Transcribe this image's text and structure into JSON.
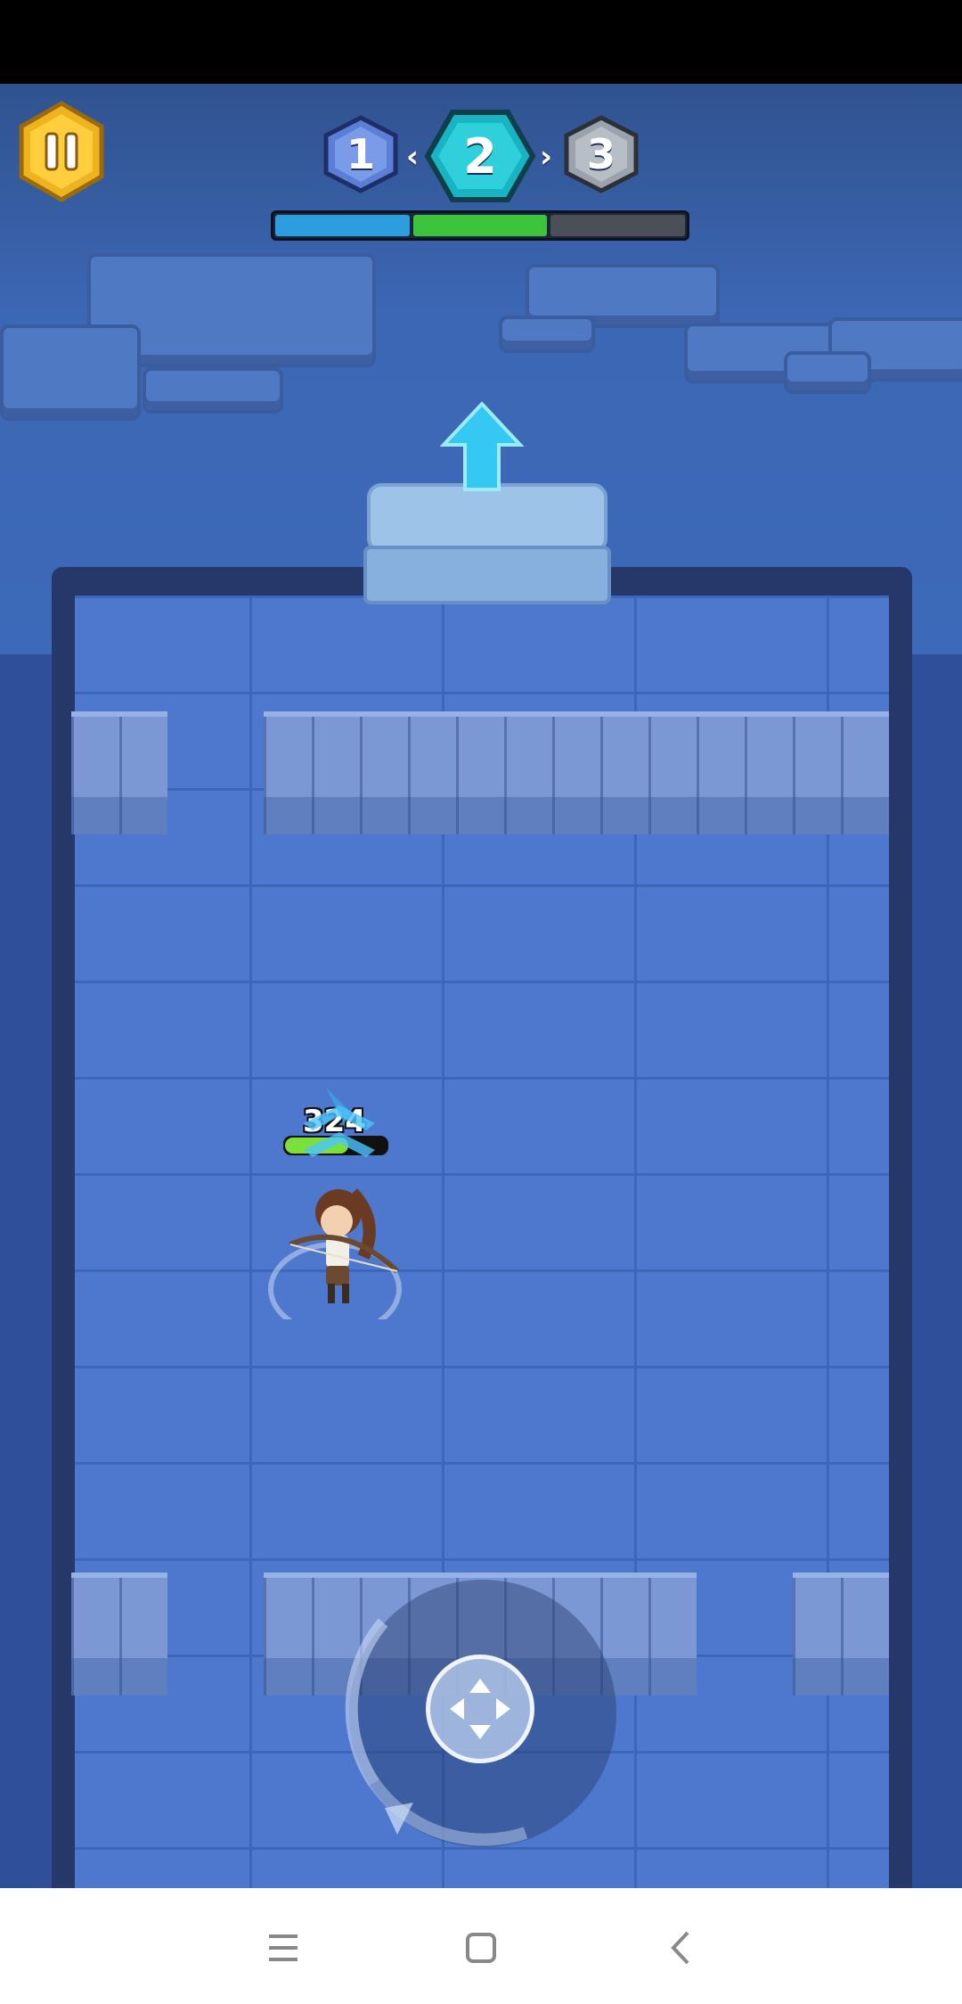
{
  "stages": {
    "items": [
      {
        "label": "1",
        "state": "done",
        "color": "#5b7fd6"
      },
      {
        "label": "2",
        "state": "current",
        "color": "#19b4c4"
      },
      {
        "label": "3",
        "state": "locked",
        "color": "#9aa3ad"
      }
    ],
    "separator": "‹",
    "separator2": "›"
  },
  "progress": {
    "segments": [
      {
        "state": "complete",
        "color": "#2d9de0"
      },
      {
        "state": "current",
        "color": "#3cc53c"
      },
      {
        "state": "pending",
        "color": "#4a4f58"
      }
    ]
  },
  "player": {
    "hp": "324",
    "hp_fraction": 0.62
  },
  "icons": {
    "pause": "pause-icon",
    "exit": "exit-arrow-icon",
    "joystick": "joystick-icon",
    "nav_menu": "menu-icon",
    "nav_home": "home-icon",
    "nav_back": "back-icon"
  },
  "colors": {
    "pause_gold": "#f0b320",
    "floor": "#4d78cd",
    "exit_arrow": "#35c8f2"
  }
}
